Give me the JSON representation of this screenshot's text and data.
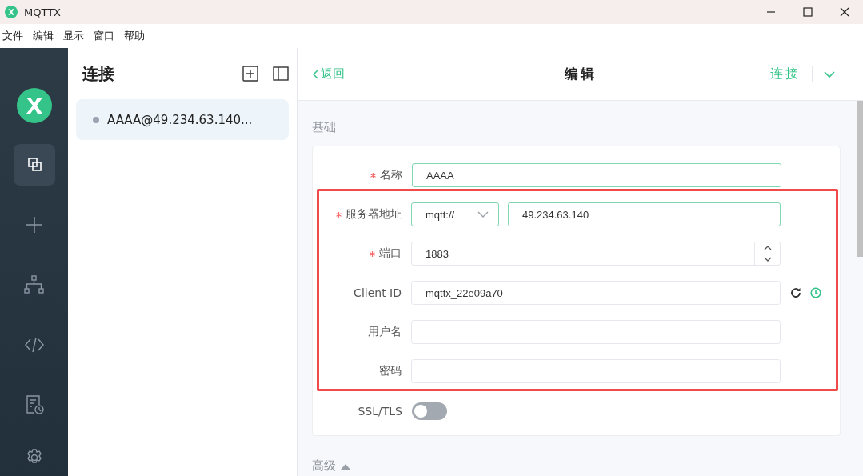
{
  "window": {
    "title": "MQTTX"
  },
  "menu": [
    "文件",
    "编辑",
    "显示",
    "窗口",
    "帮助"
  ],
  "nav": [
    {
      "kind": "connections",
      "selected": true
    },
    {
      "kind": "new",
      "selected": false
    },
    {
      "kind": "tree",
      "selected": false
    },
    {
      "kind": "script",
      "selected": false
    },
    {
      "kind": "log",
      "selected": false
    },
    {
      "kind": "settings",
      "selected": false
    }
  ],
  "connections": {
    "title": "连接",
    "items": [
      {
        "name": "AAAA@49.234.63.140...",
        "selected": true,
        "online": false
      }
    ]
  },
  "editor": {
    "back": "返回",
    "title": "编辑",
    "connect": "连接",
    "section": "基础",
    "advanced": "高级",
    "fields": [
      {
        "kind": "text",
        "label": "名称",
        "required": true,
        "value": "AAAA"
      },
      {
        "kind": "highlight",
        "fields": [
          {
            "kind": "address",
            "label": "服务器地址",
            "required": true,
            "protocol": "mqtt://",
            "value": "49.234.63.140"
          },
          {
            "kind": "number",
            "label": "端口",
            "required": true,
            "value": "1883"
          },
          {
            "kind": "clientid",
            "label": "Client ID",
            "required": false,
            "value": "mqttx_22e09a70"
          },
          {
            "kind": "text",
            "label": "用户名",
            "required": false
          },
          {
            "kind": "text",
            "label": "密码",
            "required": false
          }
        ]
      },
      {
        "kind": "toggle",
        "label": "SSL/TLS",
        "required": false,
        "on": false
      }
    ]
  }
}
